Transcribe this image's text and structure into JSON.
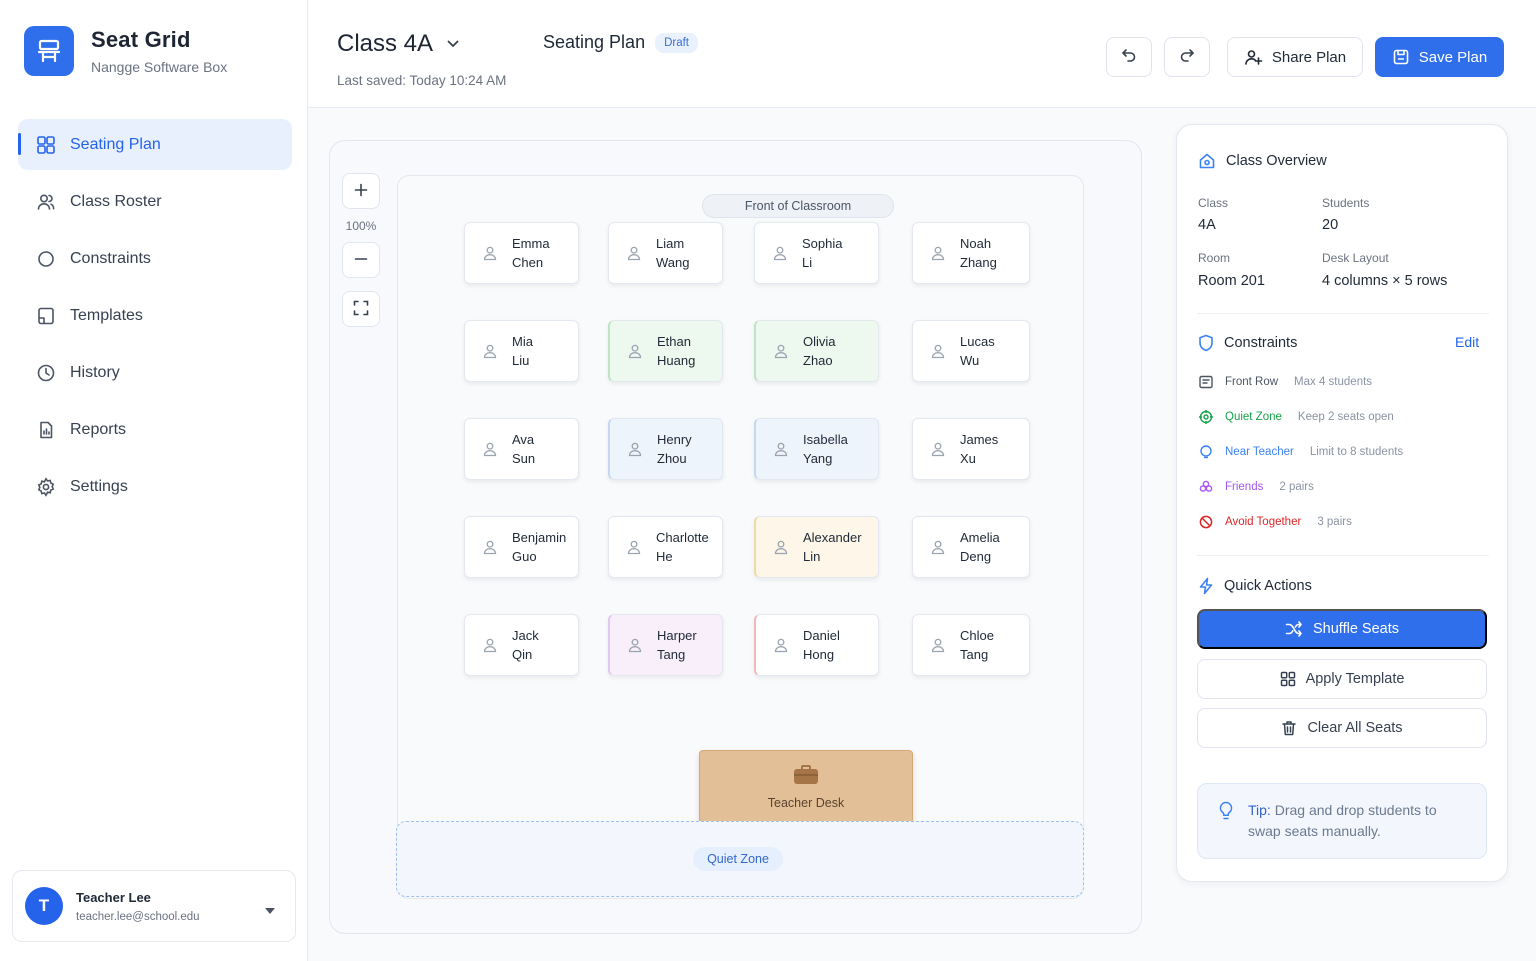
{
  "brand": {
    "title": "Seat Grid",
    "subtitle": "Nangge Software Box"
  },
  "nav": [
    {
      "label": "Seating Plan",
      "icon": "grid-icon",
      "active": true
    },
    {
      "label": "Class Roster",
      "icon": "users-icon"
    },
    {
      "label": "Constraints",
      "icon": "circle-icon"
    },
    {
      "label": "Templates",
      "icon": "template-icon"
    },
    {
      "label": "History",
      "icon": "clock-icon"
    },
    {
      "label": "Reports",
      "icon": "report-icon"
    },
    {
      "label": "Settings",
      "icon": "gear-icon"
    }
  ],
  "user": {
    "initial": "T",
    "name": "Teacher Lee",
    "email": "teacher.lee@school.edu"
  },
  "header": {
    "class_title": "Class 4A",
    "last_saved": "Last saved: Today 10:24 AM",
    "plan_title": "Seating Plan",
    "badge": "Draft",
    "share_label": "Share Plan",
    "save_label": "Save Plan"
  },
  "canvas": {
    "zoom_level": "100%",
    "front_label": "Front of Classroom",
    "teacher_desk": "Teacher Desk",
    "quiet_zone": "Quiet Zone",
    "seats": [
      {
        "first": "Emma",
        "last": "Chen",
        "tone": "white"
      },
      {
        "first": "Liam",
        "last": "Wang",
        "tone": "white"
      },
      {
        "first": "Sophia",
        "last": "Li",
        "tone": "white"
      },
      {
        "first": "Noah",
        "last": "Zhang",
        "tone": "white"
      },
      {
        "first": "Mia",
        "last": "Liu",
        "tone": "white"
      },
      {
        "first": "Ethan",
        "last": "Huang",
        "tone": "green"
      },
      {
        "first": "Olivia",
        "last": "Zhao",
        "tone": "green"
      },
      {
        "first": "Lucas",
        "last": "Wu",
        "tone": "white"
      },
      {
        "first": "Ava",
        "last": "Sun",
        "tone": "white"
      },
      {
        "first": "Henry",
        "last": "Zhou",
        "tone": "blue"
      },
      {
        "first": "Isabella",
        "last": "Yang",
        "tone": "blue"
      },
      {
        "first": "James",
        "last": "Xu",
        "tone": "white"
      },
      {
        "first": "Benjamin",
        "last": "Guo",
        "tone": "white"
      },
      {
        "first": "Charlotte",
        "last": "He",
        "tone": "white"
      },
      {
        "first": "Alexander",
        "last": "Lin",
        "tone": "amber"
      },
      {
        "first": "Amelia",
        "last": "Deng",
        "tone": "white"
      },
      {
        "first": "Jack",
        "last": "Qin",
        "tone": "white"
      },
      {
        "first": "Harper",
        "last": "Tang",
        "tone": "purple"
      },
      {
        "first": "Daniel",
        "last": "Hong",
        "tone": "red"
      },
      {
        "first": "Chloe",
        "last": "Tang",
        "tone": "white"
      }
    ]
  },
  "overview": {
    "title": "Class Overview",
    "class_label": "Class",
    "class_value": "4A",
    "students_label": "Students",
    "students_value": "20",
    "room_label": "Room",
    "room_value": "Room 201",
    "layout_label": "Desk Layout",
    "layout_value": "4 columns × 5 rows"
  },
  "constraints": {
    "title": "Constraints",
    "edit_label": "Edit",
    "items": [
      {
        "name": "Front Row",
        "desc": "Max 4 students",
        "color": "#4b5563"
      },
      {
        "name": "Quiet Zone",
        "desc": "Keep 2 seats open",
        "color": "#16a34a"
      },
      {
        "name": "Near Teacher",
        "desc": "Limit to 8 students",
        "color": "#3b82f6"
      },
      {
        "name": "Friends",
        "desc": "2 pairs",
        "color": "#a855f7"
      },
      {
        "name": "Avoid Together",
        "desc": "3 pairs",
        "color": "#dc2626"
      }
    ]
  },
  "quick_actions": {
    "title": "Quick Actions",
    "shuffle": "Shuffle Seats",
    "apply_template": "Apply Template",
    "clear_all": "Clear All Seats"
  },
  "tip": {
    "label": "Tip:",
    "text": " Drag and drop students to swap seats manually."
  },
  "colors": {
    "accent": "#2f6fec",
    "desk": "#e3bf97"
  }
}
